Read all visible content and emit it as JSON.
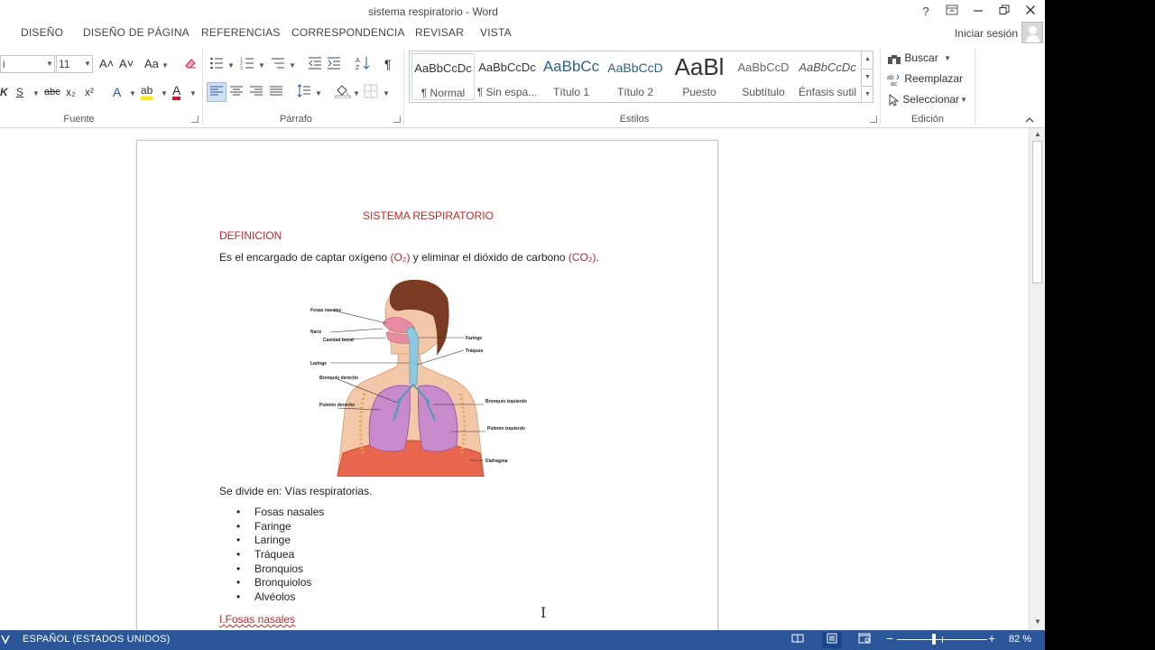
{
  "window": {
    "title": "sistema respiratorio - Word",
    "help": "?",
    "restore_ribbon": "⧉",
    "minimize": "—",
    "maximize": "❐",
    "close": "✕"
  },
  "tabs": [
    "DISEÑO",
    "DISEÑO DE PÁGINA",
    "REFERENCIAS",
    "CORRESPONDENCIA",
    "REVISAR",
    "VISTA"
  ],
  "signin": "Iniciar sesión",
  "ribbon": {
    "fuente": {
      "label": "Fuente",
      "font_name": "i",
      "font_size": "11",
      "grow": "A˄",
      "shrink": "A˅",
      "change_case": "Aa",
      "bold_partial": "K",
      "underline": "S",
      "strike": "abc",
      "subscript": "x₂",
      "superscript": "x²",
      "text_effects": "A",
      "highlight": "ab",
      "font_color": "A"
    },
    "parrafo": {
      "label": "Párrafo",
      "pilcrow": "¶"
    },
    "estilos": {
      "label": "Estilos",
      "items": [
        {
          "sample": "AaBbCcDc",
          "name": "¶ Normal"
        },
        {
          "sample": "AaBbCcDc",
          "name": "¶ Sin espa..."
        },
        {
          "sample": "AaBbCc",
          "name": "Título 1"
        },
        {
          "sample": "AaBbCcD",
          "name": "Título 2"
        },
        {
          "sample": "AaBl",
          "name": "Puesto"
        },
        {
          "sample": "AaBbCcD",
          "name": "Subtítulo"
        },
        {
          "sample": "AaBbCcDc",
          "name": "Énfasis sutil"
        }
      ]
    },
    "edicion": {
      "label": "Edición",
      "find": "Buscar",
      "replace": "Reemplazar",
      "select": "Seleccionar"
    }
  },
  "document": {
    "heading": "SISTEMA RESPIRATORIO",
    "subheading": "DEFINICION",
    "definition_pre": "Es el encargado de captar oxígeno ",
    "o2": "(O₂)",
    "definition_mid": " y eliminar el dióxido de carbono ",
    "co2": "(CO₂)",
    "definition_end": ".",
    "diagram_labels": {
      "fosas": "Fosas nasales",
      "nariz": "Nariz",
      "cavidad": "Cavidad bucal",
      "laringe": "Laringe",
      "faringe": "Faringe",
      "traquea": "Tráquea",
      "bronquio_der": "Bronquio derecho",
      "pulmon_der": "Pulmón derecho",
      "bronquio_izq": "Bronquio izquierdo",
      "pulmon_izq": "Pulmón izquierdo",
      "diafragma": "Diafragma"
    },
    "divide": "Se divide en: Vías respiratorias.",
    "list": [
      "Fosas nasales",
      "Faringe",
      "Laringe",
      "Tráquea",
      "Bronquios",
      "Bronquiolos",
      "Alvéolos"
    ],
    "next_heading_prefix": "I.",
    "next_heading": "Fosas nasales"
  },
  "statusbar": {
    "language": "ESPAÑOL (ESTADOS UNIDOS)",
    "zoom": "82 %",
    "zoom_fraction": 0.41
  },
  "colors": {
    "accent": "#2b579a",
    "heading_red": "#c0272d"
  }
}
